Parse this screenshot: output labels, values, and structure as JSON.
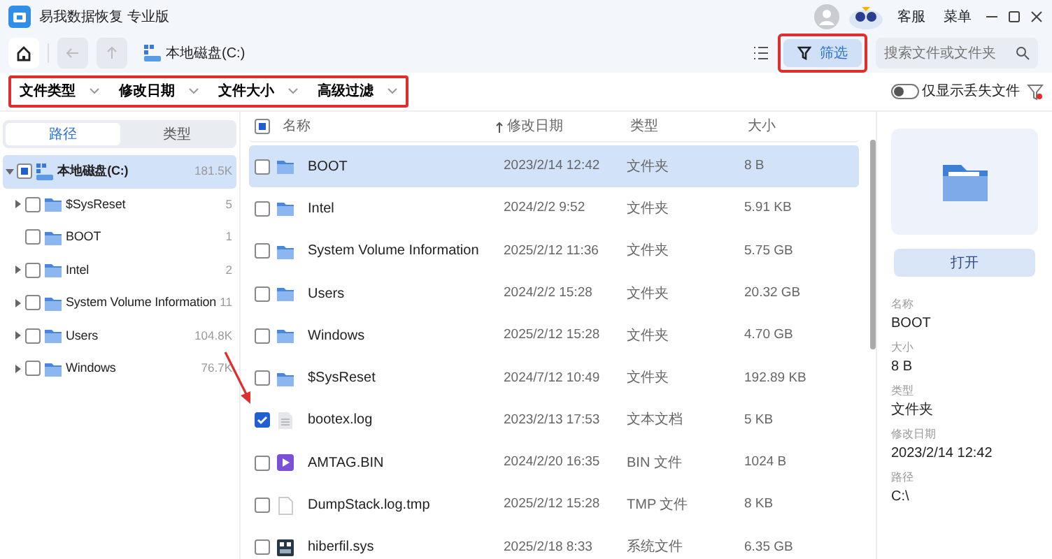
{
  "app": {
    "title": "易我数据恢复 专业版"
  },
  "header_links": [
    "客服",
    "菜单"
  ],
  "toolbar": {
    "location": "本地磁盘(C:)",
    "filter_button": {
      "label": "筛选",
      "highlighted": true
    },
    "search": {
      "placeholder": "搜索文件或文件夹"
    }
  },
  "filters": {
    "highlighted": true,
    "items": [
      "文件类型",
      "修改日期",
      "文件大小",
      "高级过滤"
    ]
  },
  "lost_only": {
    "label": "仅显示丢失文件",
    "on": false
  },
  "sidebar": {
    "tabs": [
      {
        "label": "路径",
        "selected": true
      },
      {
        "label": "类型",
        "selected": false
      }
    ],
    "tree": [
      {
        "name": "本地磁盘(C:)",
        "count": "181.5K",
        "kind": "drive",
        "partial": true,
        "checked": false,
        "selected": true,
        "expanded": true,
        "children": [
          {
            "name": "$SysReset",
            "count": "5",
            "kind": "folder",
            "partial": false,
            "checked": false,
            "selected": false,
            "expandable": true
          },
          {
            "name": "BOOT",
            "count": "1",
            "kind": "folder",
            "partial": false,
            "checked": false,
            "selected": false,
            "expandable": false
          },
          {
            "name": "Intel",
            "count": "2",
            "kind": "folder",
            "partial": false,
            "checked": false,
            "selected": false,
            "expandable": true
          },
          {
            "name": "System Volume Information",
            "count": "11",
            "kind": "folder",
            "partial": false,
            "checked": false,
            "selected": false,
            "expandable": true
          },
          {
            "name": "Users",
            "count": "104.8K",
            "kind": "folder",
            "partial": false,
            "checked": false,
            "selected": false,
            "expandable": true
          },
          {
            "name": "Windows",
            "count": "76.7K",
            "kind": "folder",
            "partial": false,
            "checked": false,
            "selected": false,
            "expandable": true
          }
        ]
      }
    ]
  },
  "table": {
    "header_partial": true,
    "columns": [
      "名称",
      "修改日期",
      "类型",
      "大小"
    ],
    "rows": [
      {
        "name": "BOOT",
        "date": "2023/2/14 12:42",
        "type": "文件夹",
        "size": "8 B",
        "kind": "folder",
        "checked": false,
        "selected": true
      },
      {
        "name": "Intel",
        "date": "2024/2/2 9:52",
        "type": "文件夹",
        "size": "5.91 KB",
        "kind": "folder",
        "checked": false,
        "selected": false
      },
      {
        "name": "System Volume Information",
        "date": "2025/2/12 11:36",
        "type": "文件夹",
        "size": "5.75 GB",
        "kind": "folder",
        "checked": false,
        "selected": false
      },
      {
        "name": "Users",
        "date": "2024/2/2 15:28",
        "type": "文件夹",
        "size": "20.32 GB",
        "kind": "folder",
        "checked": false,
        "selected": false
      },
      {
        "name": "Windows",
        "date": "2025/2/12 15:28",
        "type": "文件夹",
        "size": "4.70 GB",
        "kind": "folder",
        "checked": false,
        "selected": false
      },
      {
        "name": "$SysReset",
        "date": "2024/7/12 10:49",
        "type": "文件夹",
        "size": "192.89 KB",
        "kind": "folder",
        "checked": false,
        "selected": false
      },
      {
        "name": "bootex.log",
        "date": "2023/2/13 17:53",
        "type": "文本文档",
        "size": "5 KB",
        "kind": "text",
        "checked": true,
        "selected": false
      },
      {
        "name": "AMTAG.BIN",
        "date": "2024/2/20 16:35",
        "type": "BIN 文件",
        "size": "1024 B",
        "kind": "media",
        "checked": false,
        "selected": false
      },
      {
        "name": "DumpStack.log.tmp",
        "date": "2025/2/12 15:28",
        "type": "TMP 文件",
        "size": "8 KB",
        "kind": "blank",
        "checked": false,
        "selected": false
      },
      {
        "name": "hiberfil.sys",
        "date": "2025/2/18 8:33",
        "type": "系统文件",
        "size": "6.35 GB",
        "kind": "system",
        "checked": false,
        "selected": false
      }
    ]
  },
  "details": {
    "open_button": "打开",
    "fields": [
      {
        "label": "名称",
        "value": "BOOT"
      },
      {
        "label": "大小",
        "value": "8 B"
      },
      {
        "label": "类型",
        "value": "文件夹"
      },
      {
        "label": "修改日期",
        "value": "2023/2/14 12:42"
      },
      {
        "label": "路径",
        "value": "C:\\"
      }
    ]
  },
  "annotation_arrow": true
}
